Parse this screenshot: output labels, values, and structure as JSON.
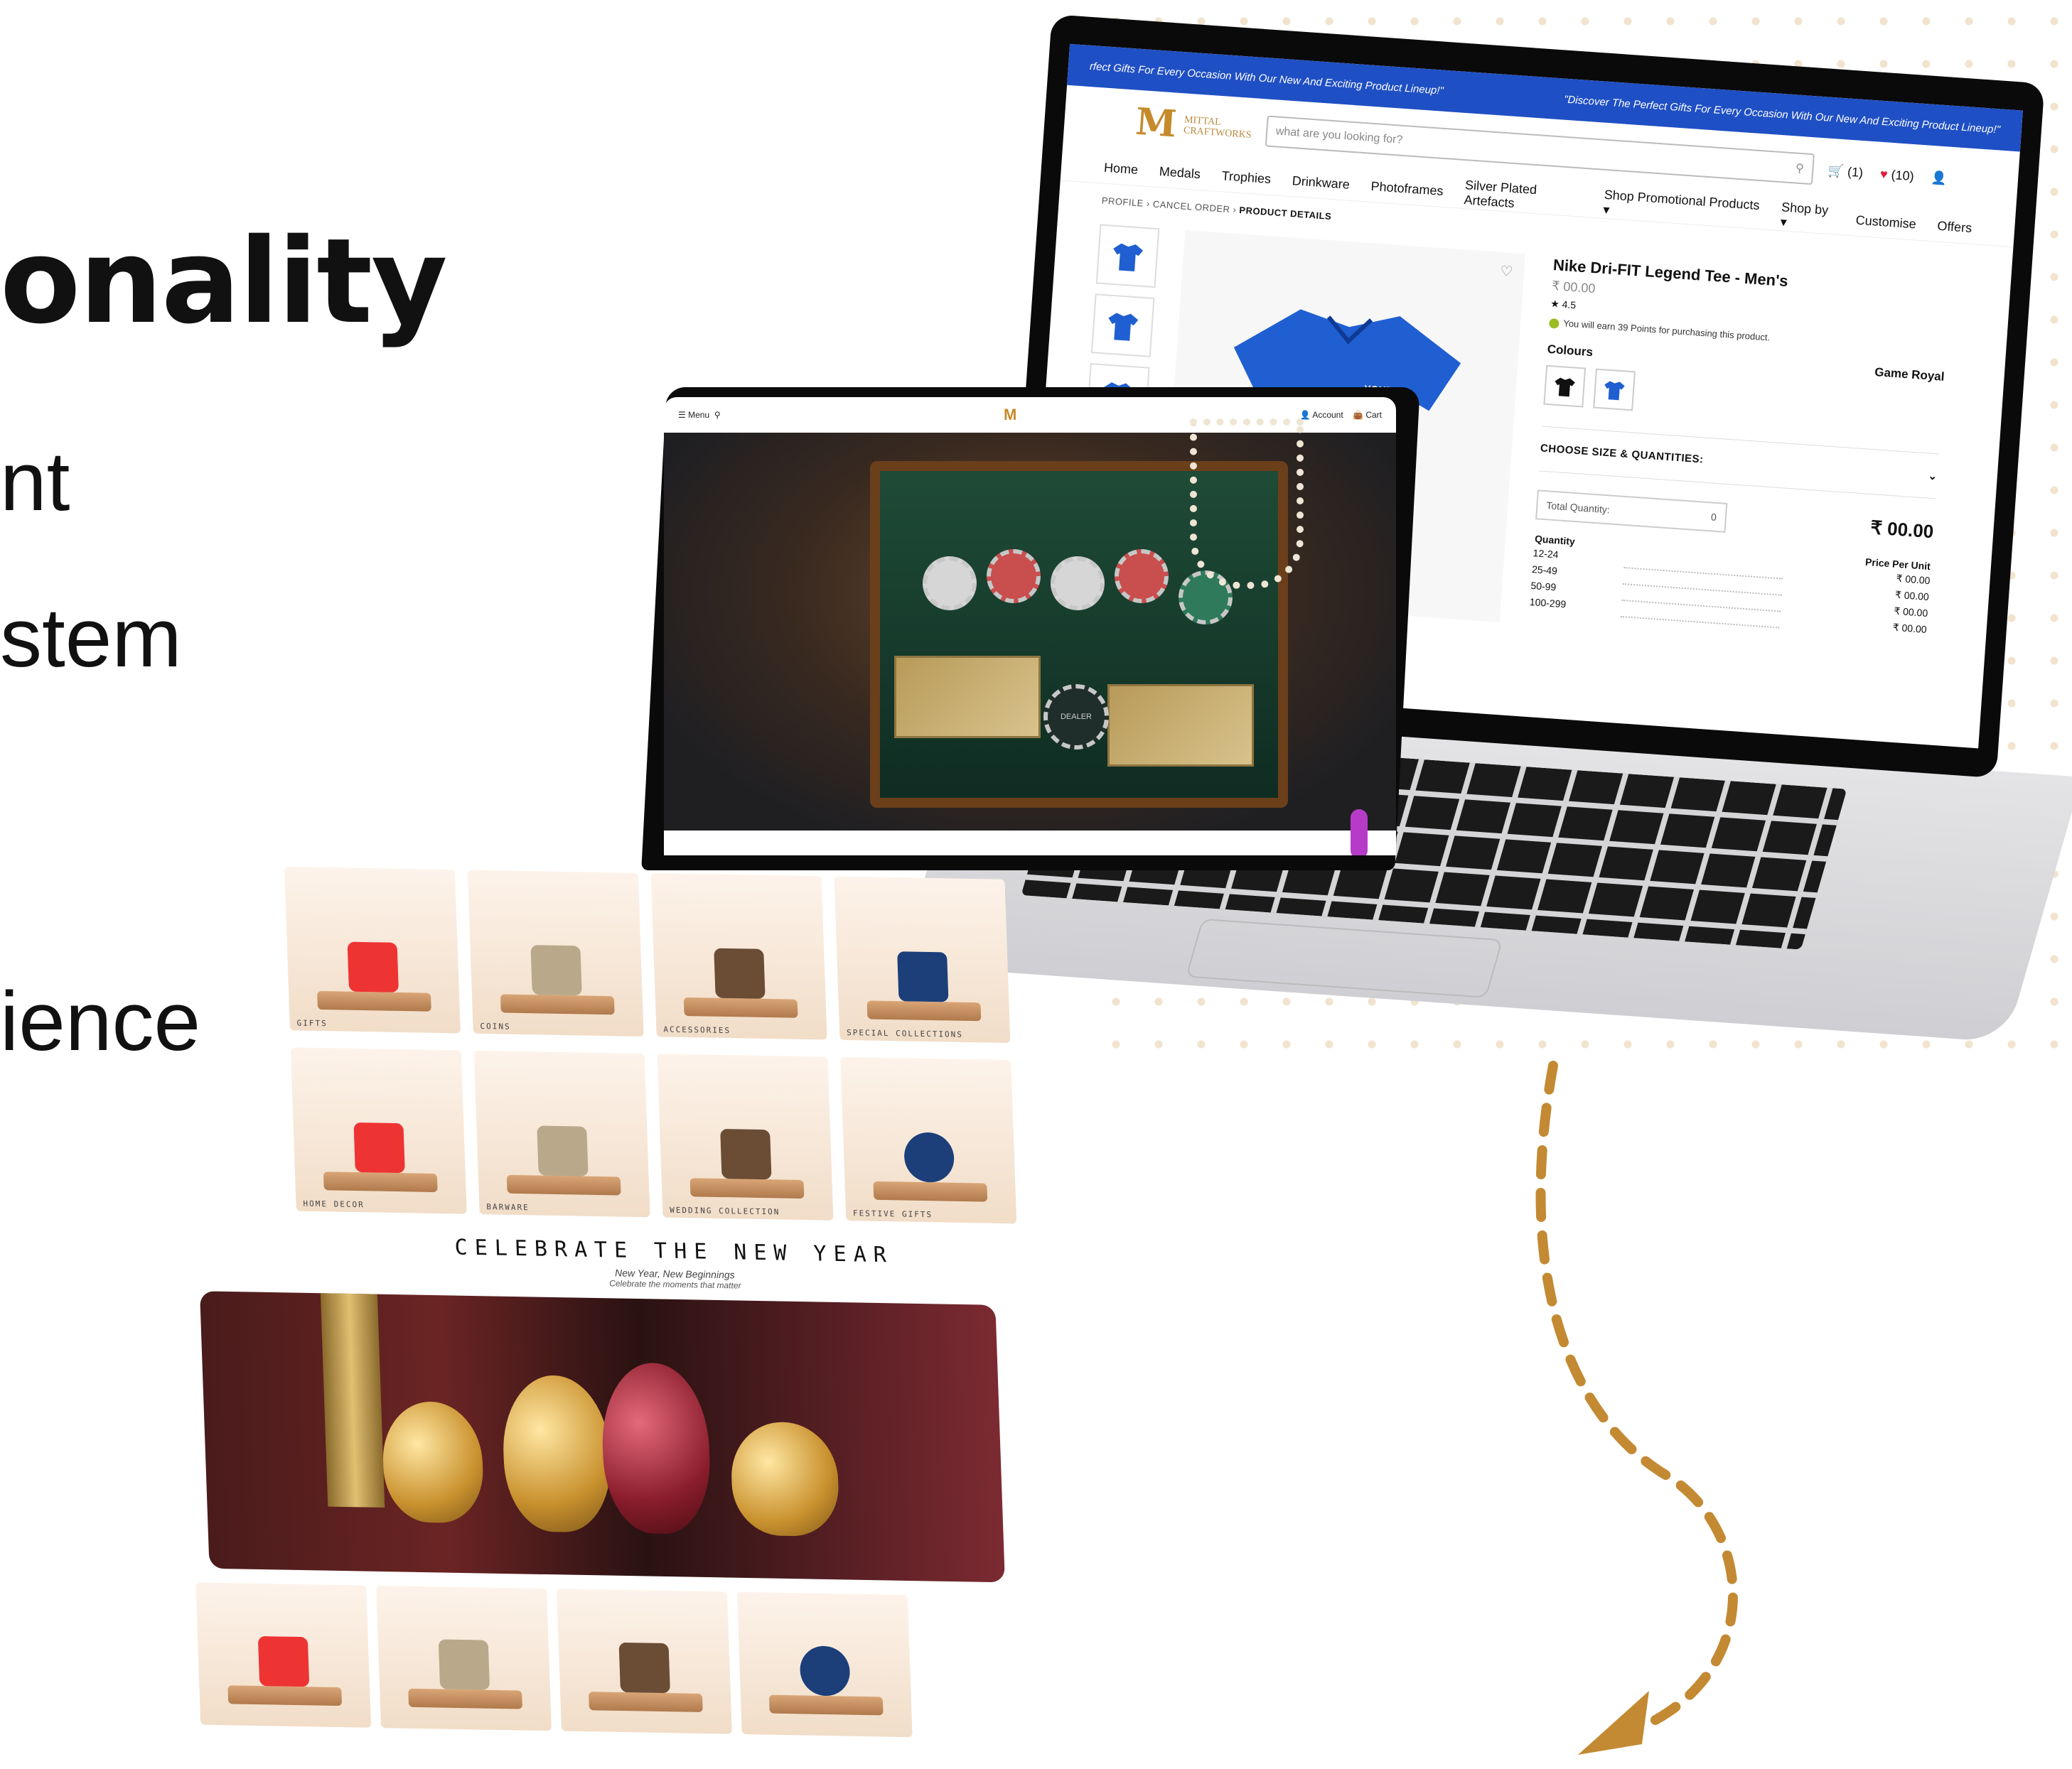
{
  "left_text": {
    "heading": "onality",
    "bullets": [
      "nt",
      "stem",
      "ience"
    ]
  },
  "product_page": {
    "announcement_left": "rfect Gifts For Every Occasion With Our New And Exciting Product Lineup!\"",
    "announcement_right": "\"Discover The Perfect Gifts For Every Occasion With Our New And Exciting Product Lineup!\"",
    "logo_letter": "M",
    "logo_line1": "MITTAL",
    "logo_line2": "CRAFTWORKS",
    "search_placeholder": "what are you looking for?",
    "cart_count": "(1)",
    "wishlist_count": "(10)",
    "nav": [
      "Home",
      "Medals",
      "Trophies",
      "Drinkware",
      "Photoframes",
      "Silver Plated Artefacts",
      "Shop Promotional Products ▾",
      "Shop by ▾",
      "Customise",
      "Offers"
    ],
    "breadcrumb": [
      "PROFILE",
      "CANCEL ORDER",
      "PRODUCT DETAILS"
    ],
    "product_title": "Nike Dri-FIT Legend Tee - Men's",
    "price": "₹ 00.00",
    "rating": "★ 4.5",
    "points_note": "You will earn 39 Points for purchasing this product.",
    "colours_label": "Colours",
    "selected_colour": "Game Royal",
    "choose_label": "CHOOSE SIZE & QUANTITIES:",
    "total_qty_label": "Total Quantity:",
    "total_qty_value": "0",
    "total_price": "₹ 00.00",
    "qty_header": "Quantity",
    "ppu_header": "Price Per Unit",
    "tiers": [
      {
        "range": "12-24",
        "price": "₹ 00.00"
      },
      {
        "range": "25-49",
        "price": "₹ 00.00"
      },
      {
        "range": "50-99",
        "price": "₹ 00.00"
      },
      {
        "range": "100-299",
        "price": "₹ 00.00"
      }
    ],
    "shirt_logo": "YOUR ✓ LOGO ↗ HERE"
  },
  "home_page": {
    "menu_label": "Menu",
    "account_label": "Account",
    "cart_label": "Cart",
    "chip_text": "DEALER",
    "categories_top": [
      "GIFTS",
      "COINS",
      "ACCESSORIES",
      "SPECIAL COLLECTIONS"
    ],
    "categories_mid": [
      "HOME DECOR",
      "BARWARE",
      "WEDDING COLLECTION",
      "FESTIVE GIFTS"
    ],
    "banner_title": "CELEBRATE THE NEW YEAR",
    "banner_sub1": "New Year, New Beginnings",
    "banner_sub2": "Celebrate the moments that matter"
  },
  "colors": {
    "brand_blue": "#1f4fc4",
    "gold": "#c58a2a",
    "arrow": "#c38a33"
  }
}
